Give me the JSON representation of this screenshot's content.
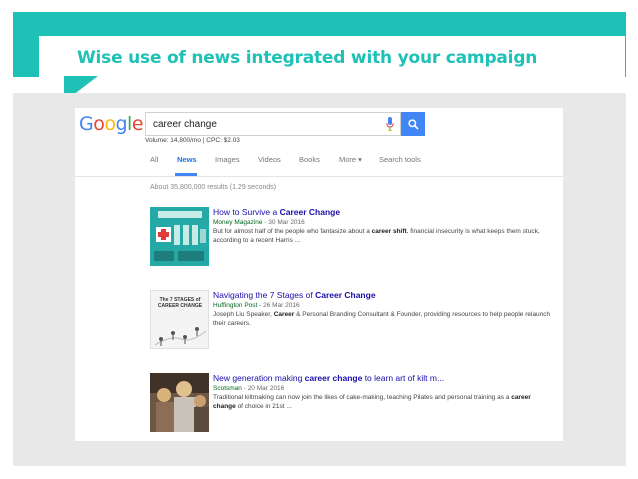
{
  "slide": {
    "title": "Wise use of news integrated with your campaign",
    "accent_color": "#1ec1b6"
  },
  "google": {
    "logo_letters": [
      {
        "char": "G",
        "color": "#4285f4"
      },
      {
        "char": "o",
        "color": "#ea4335"
      },
      {
        "char": "o",
        "color": "#fbbc05"
      },
      {
        "char": "g",
        "color": "#4285f4"
      },
      {
        "char": "l",
        "color": "#34a853"
      },
      {
        "char": "e",
        "color": "#ea4335"
      }
    ],
    "search": {
      "query": "career change",
      "volume_text": "Volume: 14,800/mo | CPC: $2.03",
      "mic_icon": "mic-icon",
      "search_icon": "search-icon"
    },
    "tabs": [
      {
        "label": "All",
        "active": false
      },
      {
        "label": "News",
        "active": true
      },
      {
        "label": "Images",
        "active": false
      },
      {
        "label": "Videos",
        "active": false
      },
      {
        "label": "Books",
        "active": false
      },
      {
        "label": "More ▾",
        "active": false
      },
      {
        "label": "Search tools",
        "active": false
      }
    ],
    "results_count": "About 35,800,000 results (1.29 seconds)",
    "results": [
      {
        "title_pre": "How to Survive a ",
        "title_bold": "Career Change",
        "title_post": "",
        "source": "Money Magazine",
        "date": "- 30 Mar 2016",
        "snippet_1": "But for almost half of the people who fantasize about a ",
        "snippet_1b": "career shift",
        "snippet_2": ", financial insecurity is what keeps them stuck, according to a recent Harris ...",
        "snippet_2b": "",
        "snippet_3": ""
      },
      {
        "title_pre": "Navigating the 7 Stages of ",
        "title_bold": "Career Change",
        "title_post": "",
        "source": "Huffington Post",
        "date": "- 26 Mar 2016",
        "thumb_text": "The 7 STAGES of CAREER CHANGE",
        "snippet_1": "Joseph Liu Speaker, ",
        "snippet_1b": "Career",
        "snippet_2": " & Personal Branding Consultant & Founder, providing resources to help people relaunch their careers.",
        "snippet_2b": "",
        "snippet_3": ""
      },
      {
        "title_pre": "New generation making ",
        "title_bold": "career change",
        "title_post": " to learn art of kilt m...",
        "source": "Scotsman",
        "date": "- 20 Mar 2016",
        "snippet_1": "Traditional kiltmaking can now join the likes of cake-making, teaching Pilates and personal training as a ",
        "snippet_1b": "career change",
        "snippet_2": " of choice in 21st ...",
        "snippet_2b": "",
        "snippet_3": ""
      }
    ]
  }
}
